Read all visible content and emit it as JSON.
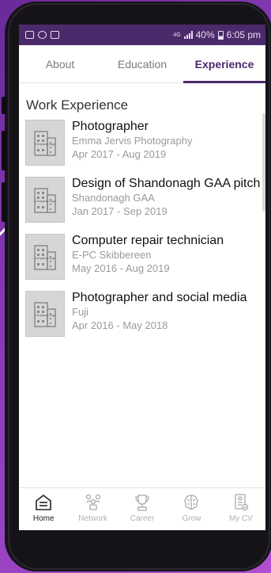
{
  "status_bar": {
    "network": "4G",
    "battery": "40%",
    "time": "6:05 pm"
  },
  "tabs": [
    {
      "label": "About",
      "active": false
    },
    {
      "label": "Education",
      "active": false
    },
    {
      "label": "Experience",
      "active": true
    }
  ],
  "section_title": "Work Experience",
  "logo_placeholder": "Company Logo",
  "experience": [
    {
      "title": "Photographer",
      "company": "Emma Jervis Photography",
      "dates": "Apr 2017 - Aug 2019"
    },
    {
      "title": "Design of Shandonagh GAA pitch",
      "company": "Shandonagh GAA",
      "dates": "Jan 2017 - Sep 2019"
    },
    {
      "title": "Computer repair technician",
      "company": "E-PC Skibbereen",
      "dates": "May 2016 - Aug 2019"
    },
    {
      "title": "Photographer and social media",
      "company": "Fuji",
      "dates": "Apr 2016 - May 2018"
    }
  ],
  "bottom_nav": [
    {
      "label": "Home",
      "icon": "home-icon",
      "active": true
    },
    {
      "label": "Network",
      "icon": "network-icon",
      "active": false
    },
    {
      "label": "Career",
      "icon": "trophy-icon",
      "active": false
    },
    {
      "label": "Grow",
      "icon": "brain-icon",
      "active": false
    },
    {
      "label": "My CV",
      "icon": "cv-icon",
      "active": false
    }
  ],
  "colors": {
    "accent": "#4a2a6c",
    "status_bar": "#4b2a6b",
    "background_gradient_start": "#6a2a9a",
    "background_gradient_end": "#b04fd0"
  }
}
